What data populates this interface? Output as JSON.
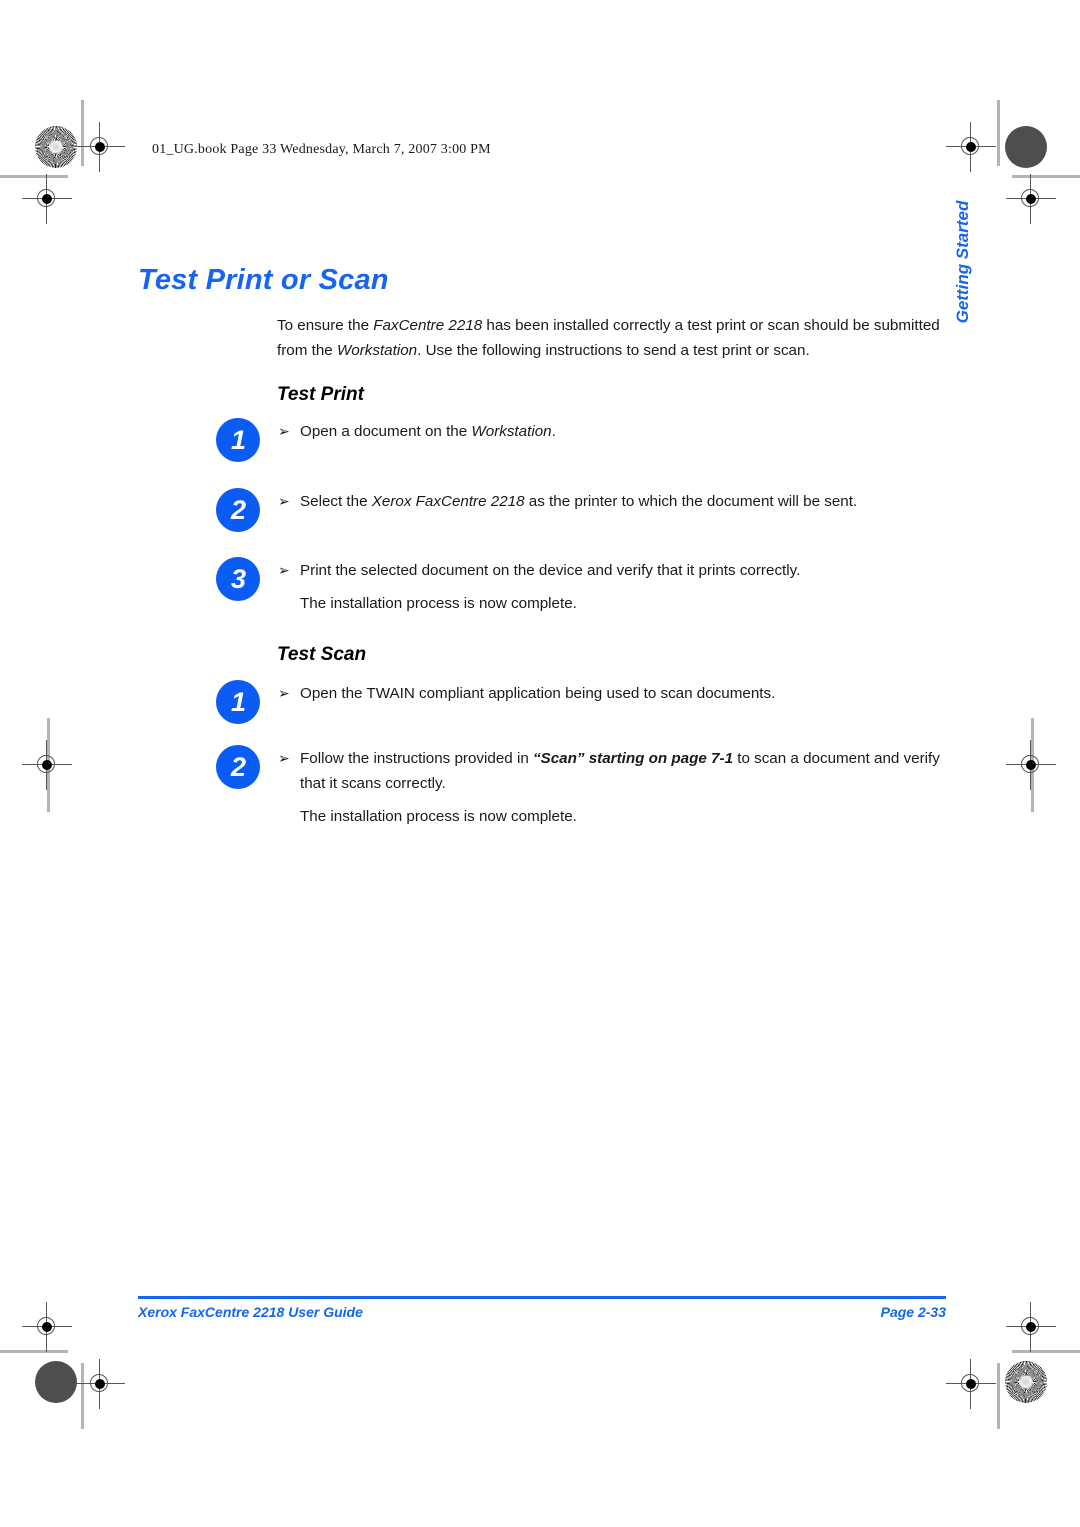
{
  "document": {
    "slug_line": "01_UG.book  Page 33  Wednesday, March 7, 2007  3:00 PM",
    "page_title": "Test Print or Scan",
    "side_tab": "Getting Started",
    "accent_color": "#1565F0",
    "badge_color": "#0B5CF5"
  },
  "intro": {
    "part1": "To ensure the ",
    "italic1": "FaxCentre 2218",
    "part2": " has been installed correctly a test print or scan should be submitted from the ",
    "italic2": "Workstation",
    "part3": ". Use the following instructions to send a test print or scan."
  },
  "sections": [
    {
      "heading": "Test Print",
      "steps": [
        {
          "number": "1",
          "arrow": "➢",
          "text_part1": "Open a document on the ",
          "italic": "Workstation",
          "text_part2": ".",
          "sub": ""
        },
        {
          "number": "2",
          "arrow": "➢",
          "text_part1": "Select the ",
          "italic": "Xerox FaxCentre 2218",
          "text_part2": " as the printer to which the document will be sent.",
          "sub": ""
        },
        {
          "number": "3",
          "arrow": "➢",
          "text_part1": "Print the selected document on the device and verify that it prints correctly.",
          "italic": "",
          "text_part2": "",
          "sub": "The installation process is now complete."
        }
      ]
    },
    {
      "heading": "Test Scan",
      "steps": [
        {
          "number": "1",
          "arrow": "➢",
          "text_part1": "Open the TWAIN compliant application being used to scan documents.",
          "italic": "",
          "text_part2": "",
          "sub": ""
        },
        {
          "number": "2",
          "arrow": "➢",
          "text_part1": "Follow the instructions provided in ",
          "italic": "“Scan” starting on page 7-1",
          "text_part2": " to scan a document and verify that it scans correctly.",
          "sub": "The installation process is now complete."
        }
      ]
    }
  ],
  "footer": {
    "left": "Xerox FaxCentre 2218 User Guide",
    "right": "Page 2-33"
  }
}
